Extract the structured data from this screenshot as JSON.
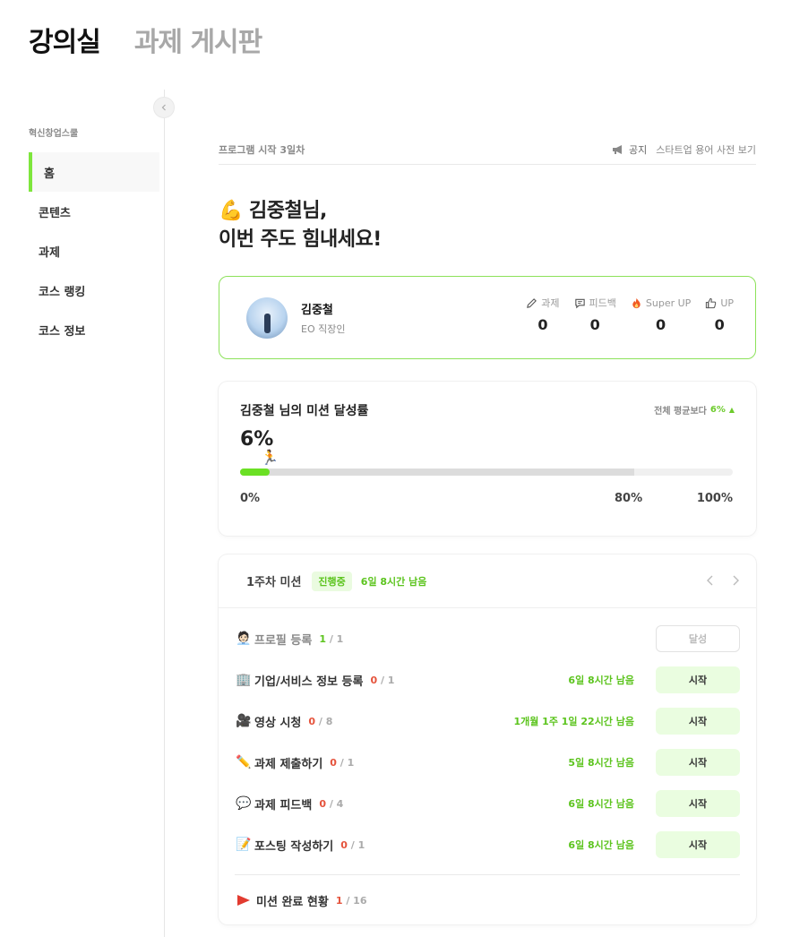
{
  "top_nav": {
    "tabs": [
      {
        "label": "강의실",
        "active": true
      },
      {
        "label": "과제 게시판",
        "active": false
      }
    ]
  },
  "sidebar": {
    "collapse_icon": "chevron-left-icon",
    "group_label": "혁신창업스쿨",
    "items": [
      {
        "label": "홈",
        "active": true
      },
      {
        "label": "콘텐츠"
      },
      {
        "label": "과제"
      },
      {
        "label": "코스 랭킹"
      },
      {
        "label": "코스 정보"
      }
    ]
  },
  "header": {
    "program_day": "프로그램 시작 3일차",
    "notice_label": "공지",
    "dictionary_label": "스타트업 용어 사전 보기"
  },
  "greeting": {
    "line1": "💪 김중철님,",
    "line2": "이번 주도 힘내세요!"
  },
  "profile": {
    "name": "김중철",
    "role": "EO 직장인",
    "stats": [
      {
        "label": "과제",
        "value": "0",
        "icon": "pencil-icon"
      },
      {
        "label": "피드백",
        "value": "0",
        "icon": "comment-icon"
      },
      {
        "label": "Super UP",
        "value": "0",
        "icon": "fire-icon"
      },
      {
        "label": "UP",
        "value": "0",
        "icon": "thumbs-up-icon"
      }
    ]
  },
  "achievement": {
    "title": "김중철 님의 미션 달성률",
    "value": "6%",
    "progress": 0.06,
    "target": 0.8,
    "avg_label": "전체 평균보다",
    "avg_value": "6%",
    "avg_arrow": "▲",
    "scale": {
      "min": "0%",
      "target": "80%",
      "max": "100%"
    },
    "runner_emoji": "🏃"
  },
  "mission": {
    "week": "1주차 미션",
    "status": "진행중",
    "remaining": "6일 8시간 남음",
    "items": [
      {
        "emoji": "🧑🏻‍💼",
        "name": "프로필 등록",
        "done": "1",
        "total": "/ 1",
        "remaining": "",
        "button": "달성",
        "state": "achieved"
      },
      {
        "emoji": "🏢",
        "name": "기업/서비스 정보 등록",
        "done": "0",
        "total": "/ 1",
        "remaining": "6일 8시간 남음",
        "button": "시작",
        "state": "start"
      },
      {
        "emoji": "🎥",
        "name": "영상 시청",
        "done": "0",
        "total": "/ 8",
        "remaining": "1개월 1주 1일 22시간 남음",
        "button": "시작",
        "state": "start"
      },
      {
        "emoji": "✏️",
        "name": "과제 제출하기",
        "done": "0",
        "total": "/ 1",
        "remaining": "5일 8시간 남음",
        "button": "시작",
        "state": "start"
      },
      {
        "emoji": "💬",
        "name": "과제 피드백",
        "done": "0",
        "total": "/ 4",
        "remaining": "6일 8시간 남음",
        "button": "시작",
        "state": "start"
      },
      {
        "emoji": "📝",
        "name": "포스팅 작성하기",
        "done": "0",
        "total": "/ 1",
        "remaining": "6일 8시간 남음",
        "button": "시작",
        "state": "start"
      }
    ],
    "footer": {
      "name": "미션 완료 현황",
      "done": "1",
      "total": "/ 16"
    }
  },
  "colors": {
    "accent": "#6be024",
    "accent_text": "#5cc41e",
    "danger": "#e5533c",
    "card_border": "#8de25b"
  }
}
